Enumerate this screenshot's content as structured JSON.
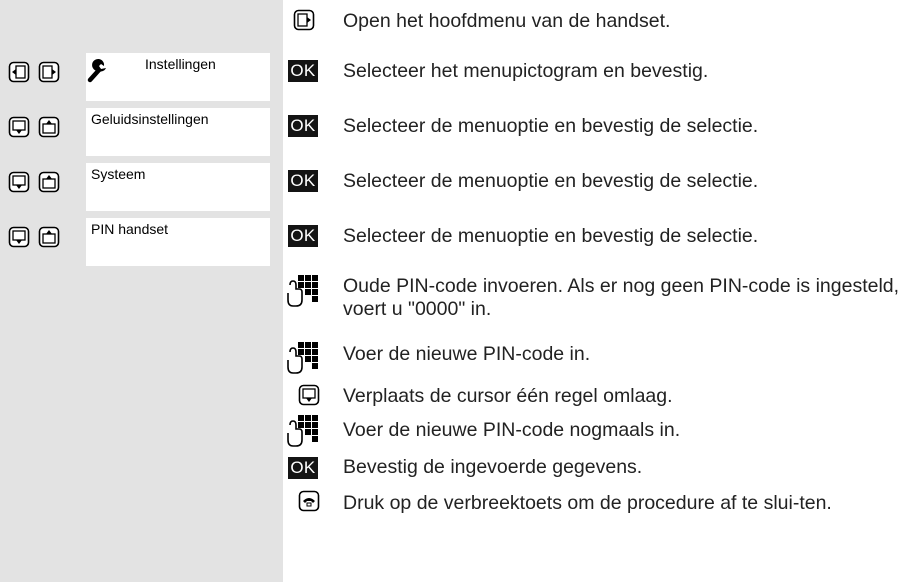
{
  "menu_steps": [
    {
      "label": "Instellingen",
      "nav_keys": [
        "left-key",
        "right-key"
      ],
      "icon": "wrench-icon"
    },
    {
      "label": "Geluidsinstellingen",
      "nav_keys": [
        "down-key",
        "up-key"
      ]
    },
    {
      "label": "Systeem",
      "nav_keys": [
        "down-key",
        "up-key"
      ]
    },
    {
      "label": "PIN handset",
      "nav_keys": [
        "down-key",
        "up-key"
      ]
    }
  ],
  "ok_label": "OK",
  "instructions": [
    {
      "icon": "menu-key-icon",
      "text": "Open het hoofdmenu van de handset."
    },
    {
      "icon": "ok-key",
      "text": "Selecteer het menupictogram en bevestig."
    },
    {
      "icon": "ok-key",
      "text": "Selecteer de menuoptie en bevestig de selectie."
    },
    {
      "icon": "ok-key",
      "text": "Selecteer de menuoptie en bevestig de selectie."
    },
    {
      "icon": "ok-key",
      "text": "Selecteer de menuoptie en bevestig de selectie."
    },
    {
      "icon": "keypad-icon",
      "text": "Oude PIN-code invoeren. Als er nog geen PIN-code is ingesteld, voert u \"0000\" in."
    },
    {
      "icon": "keypad-icon",
      "text": "Voer de nieuwe PIN-code in."
    },
    {
      "icon": "down-key-icon",
      "text": "Verplaats de cursor één regel omlaag."
    },
    {
      "icon": "keypad-icon",
      "text": "Voer de nieuwe PIN-code nogmaals in."
    },
    {
      "icon": "ok-key",
      "text": "Bevestig de ingevoerde gegevens."
    },
    {
      "icon": "end-call-key-icon",
      "text": "Druk op de verbreektoets om de procedure af te slui-ten."
    }
  ]
}
